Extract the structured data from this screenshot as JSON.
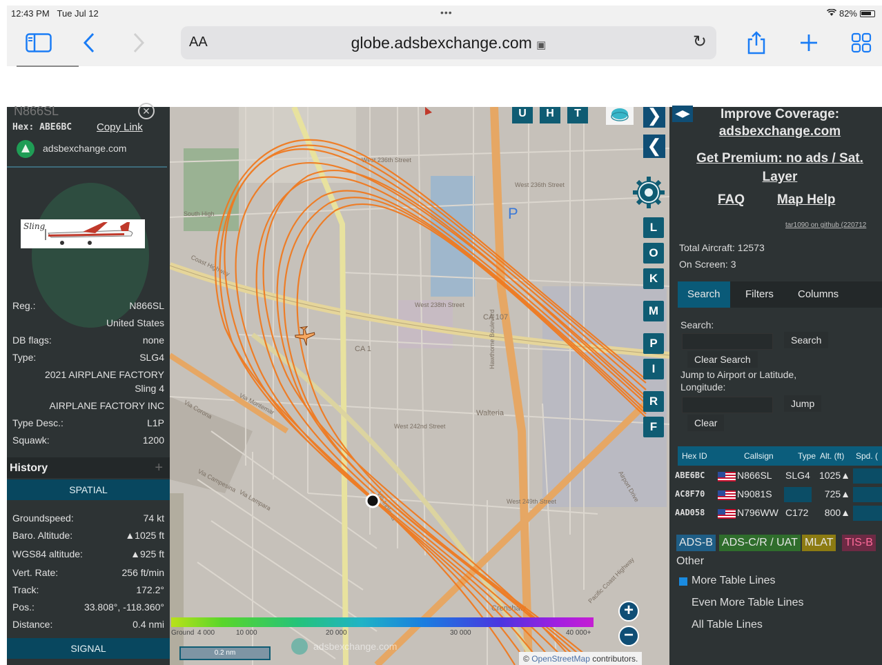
{
  "status_bar": {
    "time": "12:43 PM",
    "date": "Tue Jul 12",
    "battery": "82%"
  },
  "browser": {
    "text_size": "AA",
    "url": "globe.adsbexchange.com"
  },
  "aircraft": {
    "reg_heading": "N866SL",
    "hex_line": "Hex: ABE6BC",
    "copy_link": "Copy Link",
    "source": "adsbexchange.com",
    "fields": [
      {
        "key": "Reg.:",
        "value": "N866SL"
      },
      {
        "key": "",
        "value": "United States"
      },
      {
        "key": "DB flags:",
        "value": "none"
      },
      {
        "key": "Type:",
        "value": "SLG4"
      },
      {
        "key": "",
        "value": "2021 AIRPLANE FACTORY"
      },
      {
        "key": "",
        "value": "Sling 4"
      },
      {
        "key": "",
        "value": "AIRPLANE FACTORY INC"
      },
      {
        "key": "Type Desc.:",
        "value": "L1P"
      },
      {
        "key": "Squawk:",
        "value": "1200"
      }
    ],
    "history_label": "History",
    "history_plus": "+",
    "spatial_tab": "SPATIAL",
    "spatial": [
      {
        "key": "Groundspeed:",
        "value": "74 kt"
      },
      {
        "key": "Baro. Altitude:",
        "value": "▲1025 ft"
      },
      {
        "key": "WGS84 altitude:",
        "value": "▲925 ft"
      },
      {
        "key": "Vert. Rate:",
        "value": "256 ft/min"
      },
      {
        "key": "Track:",
        "value": "172.2°"
      },
      {
        "key": "Pos.:",
        "value": "33.808°, -118.360°"
      },
      {
        "key": "Distance:",
        "value": "0.4 nmi"
      }
    ],
    "signal_tab": "SIGNAL"
  },
  "map": {
    "top_buttons": [
      "U",
      "H",
      "T"
    ],
    "side_buttons": [
      "L",
      "O",
      "K",
      "M",
      "P",
      "I",
      "R",
      "F"
    ],
    "street_labels": [
      "West 236th Street",
      "West 236th Street",
      "West 238th Street",
      "CA 107",
      "CA 1",
      "Coast Highway",
      "West 242nd Street",
      "West 249th Street",
      "Via Campesina",
      "Via Lampara",
      "Via Montemar",
      "Via Corona",
      "Pacific Coast Highway",
      "Airport Drive",
      "Hawthorne Boulevard",
      "Walteria",
      "Crenshaw",
      "South High",
      "Via Inglesia"
    ],
    "colorbar_labels": [
      "Ground",
      "4 000",
      "10 000",
      "20 000",
      "30 000",
      "40 000+"
    ],
    "scale": "0.2 nm",
    "watermark": "adsbexchange.com",
    "attribution_prefix": "©",
    "attribution_link": "OpenStreetMap",
    "attribution_suffix": "contributors.",
    "zoom_in": "+",
    "zoom_out": "−"
  },
  "sidebar": {
    "improve_1": "Improve Coverage:",
    "improve_2": "adsbexchange.com",
    "premium_1": "Get Premium: no ads / Sat.",
    "premium_2": "Layer",
    "faq": "FAQ",
    "map_help": "Map Help",
    "version": "tar1090 on github (220712",
    "total_aircraft": "Total Aircraft: 12573",
    "on_screen": "On Screen: 3",
    "tabs": [
      "Search",
      "Filters",
      "Columns"
    ],
    "search_label": "Search:",
    "search_btn": "Search",
    "clear_search": "Clear Search",
    "jump_label_1": "Jump to Airport or Latitude,",
    "jump_label_2": "Longitude:",
    "jump_btn": "Jump",
    "clear_btn": "Clear",
    "table_headers": [
      "Hex ID",
      "Callsign",
      "Type",
      "Alt. (ft)",
      "Spd. ("
    ],
    "table_rows": [
      {
        "hex": "ABE6BC",
        "callsign": "N866SL",
        "type": "SLG4",
        "alt": "1025▲"
      },
      {
        "hex": "AC8F70",
        "callsign": "N9081S",
        "type": "",
        "alt": "725▲"
      },
      {
        "hex": "AAD058",
        "callsign": "N796WW",
        "type": "C172",
        "alt": "800▲"
      }
    ],
    "legend": [
      {
        "label": "ADS-B",
        "color": "#1f5e86",
        "text": "#e6e6e6"
      },
      {
        "label": "ADS-C/R / UAT",
        "color": "#2f6d2c",
        "text": "#e6e6e6"
      },
      {
        "label": "MLAT",
        "color": "#8c7b12",
        "text": "#e6e6e6"
      },
      {
        "label": "TIS-B",
        "color": "#6d2a44",
        "text": "#ff6b9a"
      }
    ],
    "legend_other": "Other",
    "options": [
      "More Table Lines",
      "Even More Table Lines",
      "All Table Lines"
    ]
  },
  "colors": {
    "track": "#f07a20",
    "panel": "#2d3334",
    "accent": "#0f5c73",
    "link": "#1a7cf5"
  }
}
